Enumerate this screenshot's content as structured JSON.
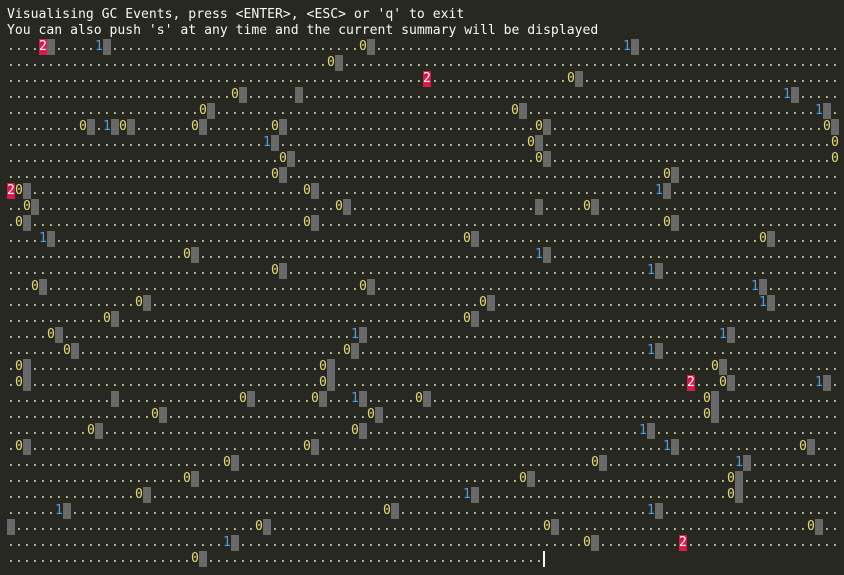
{
  "header": {
    "line1": "Visualising GC Events, press <ENTER>, <ESC> or 'q' to exit",
    "line2": "You can also push 's' at any time and the current summary will be displayed"
  },
  "legend": {
    "dot": ".",
    "generation_0": "0",
    "generation_1": "1",
    "generation_2": "2",
    "block": "heap segment"
  },
  "colors": {
    "background": "#272822",
    "text": "#f8f8f2",
    "dot": "#cfcfa0",
    "gen0": "#e6db74",
    "gen1": "#4fa0e0",
    "gen2_bg": "#d81b4a",
    "block": "#686868"
  },
  "rows": [
    "....2#.....1#...............................0#...............................1#...........................",
    "........................................0#................................................................1",
    "....................................................2.................0#...................................",
    "............................0#......#............................................................1#........",
    "........................0#.....................................0#....................................1#....",
    ".........0#.1#0#.......0#........0#...............................0#..................................0#...",
    "................................1#...............................0#....................................0#..",
    "..................................0#..............................0#...................................0#...",
    ".................................0#...............................................0#......................",
    "20#..................................0#..........................................1#.......................",
    "..0#.....................................0#.......................#.....0#..............................",
    ".0#..................................0#...........................................0#......................",
    "....1#...................................................0#...................................0#..........",
    "......................0#..........................................1#.......................................0#...",
    ".................................0#.............................................1#.......................",
    "...0#.......................................0#...............................................1#..........",
    "................0#.........................................0#.................................1#..........",
    "............0#...........................................0#..............................................",
    ".....0#....................................1#............................................1#..............",
    ".......0#.................................0#....................................1#........................",
    ".0#....................................0#...............................................0#...............",
    ".0#....................................0#............................................2...0#..........1#..",
    ".............#...............0#.......0#...1#......0#..................................0#................",
    "..................0#.........................0#........................................0#................",
    "..........0#...............................0#..................................1#........................",
    ".0#..................................0#...........................................1#...............0#...",
    "...........................0#............................................0#................1#............",
    "......................0#........................................0#........................0#..............",
    "................0#.......................................1#...............................0#..............",
    "......1#.......................................0#...............................1#......................0",
    "#..............................0#..................................0#...............................0#...",
    "...........................1#...........................................0#..........2.....................0#",
    ".......................0#.........................................."
  ]
}
